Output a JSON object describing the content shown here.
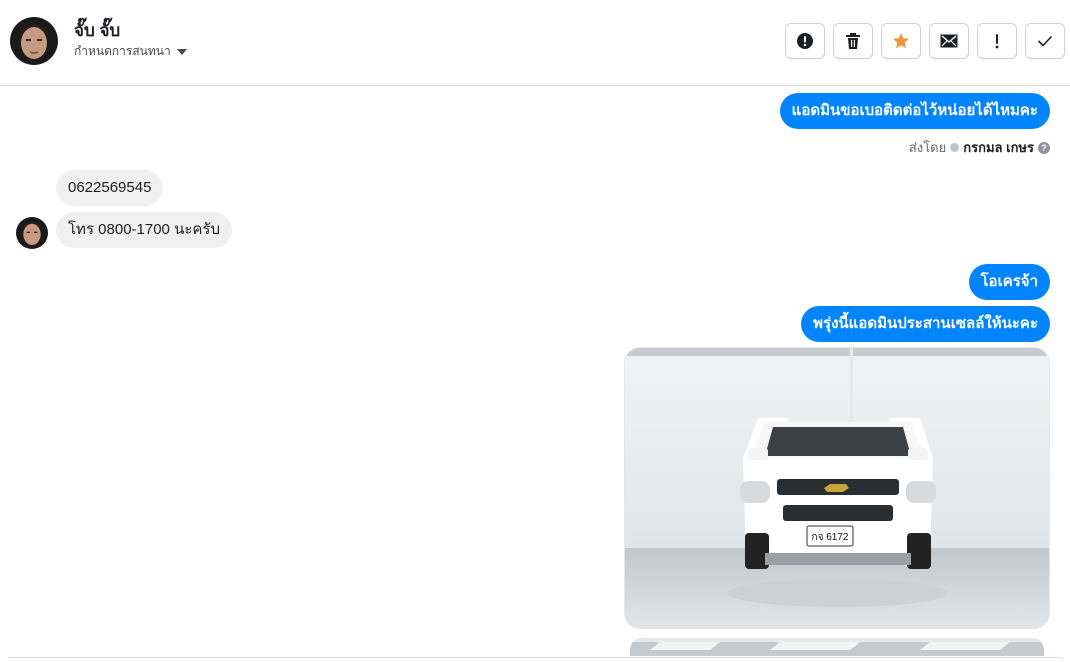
{
  "header": {
    "contact_name": "จั๊บ จั๊บ",
    "assign_label": "กำหนดการสนทนา",
    "actions": [
      {
        "name": "spam-alert-button",
        "icon": "alert-circle-icon"
      },
      {
        "name": "delete-button",
        "icon": "trash-icon"
      },
      {
        "name": "star-button",
        "icon": "star-icon"
      },
      {
        "name": "mark-unread-button",
        "icon": "envelope-icon"
      },
      {
        "name": "follow-up-button",
        "icon": "exclamation-icon"
      },
      {
        "name": "mark-done-button",
        "icon": "check-icon"
      }
    ]
  },
  "colors": {
    "outgoing_bubble": "#0084ff",
    "incoming_bubble": "#f0f0f0",
    "star": "#f5923e"
  },
  "messages": [
    {
      "direction": "outgoing",
      "text": "แอดมินขอเบอติดต่อไว้หน่อยได้ไหมคะ"
    },
    {
      "direction": "incoming",
      "text": "0622569545"
    },
    {
      "direction": "incoming",
      "text": "โทร 0800-1700 นะครับ"
    },
    {
      "direction": "outgoing",
      "text": "โอเครจ้า"
    },
    {
      "direction": "outgoing",
      "text": "พรุ่งนี้แอดมินประสานเซลล์ให้นะคะ"
    }
  ],
  "sent_by": {
    "prefix": "ส่งโดย",
    "name": "กรกมล เกษร"
  },
  "photo": {
    "license_plate": "กจ 6172"
  }
}
